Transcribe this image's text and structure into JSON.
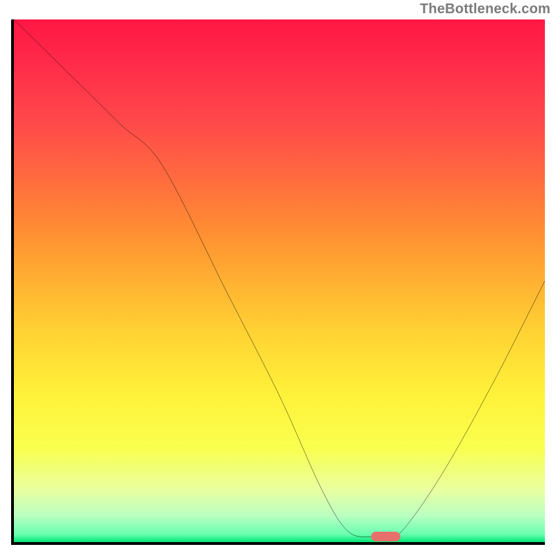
{
  "watermark": "TheBottleneck.com",
  "chart_data": {
    "type": "line",
    "title": "",
    "xlabel": "",
    "ylabel": "",
    "xlim": [
      0,
      100
    ],
    "ylim": [
      0,
      100
    ],
    "grid": false,
    "legend": false,
    "series": [
      {
        "name": "curve",
        "x": [
          0,
          10,
          20,
          28,
          40,
          50,
          58,
          63,
          68,
          72,
          80,
          90,
          100
        ],
        "y": [
          100,
          90,
          80,
          72,
          48,
          28,
          10,
          2,
          1,
          1,
          12,
          30,
          50
        ]
      }
    ],
    "marker": {
      "x": 70,
      "y": 1
    },
    "gradient_stops": [
      {
        "pos": 0.0,
        "color": "#ff1744"
      },
      {
        "pos": 0.1,
        "color": "#ff2f4a"
      },
      {
        "pos": 0.2,
        "color": "#ff4a4a"
      },
      {
        "pos": 0.3,
        "color": "#ff6a3f"
      },
      {
        "pos": 0.4,
        "color": "#ff8c33"
      },
      {
        "pos": 0.5,
        "color": "#ffb032"
      },
      {
        "pos": 0.6,
        "color": "#ffd333"
      },
      {
        "pos": 0.72,
        "color": "#fff23a"
      },
      {
        "pos": 0.82,
        "color": "#f9ff4e"
      },
      {
        "pos": 0.9,
        "color": "#e9ffa0"
      },
      {
        "pos": 0.95,
        "color": "#b8ffc2"
      },
      {
        "pos": 0.985,
        "color": "#6affb0"
      },
      {
        "pos": 1.0,
        "color": "#00e676"
      }
    ]
  }
}
